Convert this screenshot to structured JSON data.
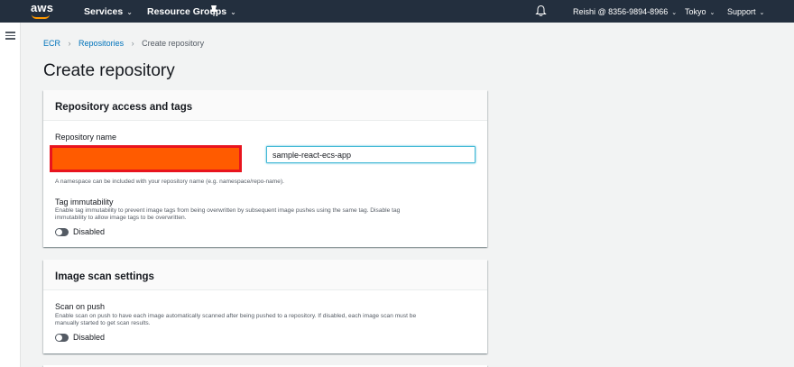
{
  "topnav": {
    "logo": "aws",
    "services": "Services",
    "resource_groups": "Resource Groups",
    "account": "Reishi @ 8356-9894-8966",
    "region": "Tokyo",
    "support": "Support",
    "chevron": "⌄"
  },
  "breadcrumb": {
    "items": [
      "ECR",
      "Repositories",
      "Create repository"
    ],
    "separator": "›"
  },
  "page": {
    "title": "Create repository"
  },
  "repo_access": {
    "header": "Repository access and tags",
    "name_label": "Repository name",
    "name_value": "sample-react-ecs-app",
    "namespace_hint": "A namespace can be included with your repository name (e.g. namespace/repo-name).",
    "tag_immutability_label": "Tag immutability",
    "tag_immutability_desc_1": "Enable tag immutability to prevent image tags from being overwritten by subsequent image pushes using the same tag. Disable tag",
    "tag_immutability_desc_2": "immutability to allow image tags to be overwritten.",
    "tag_immutability_state": "Disabled"
  },
  "image_scan": {
    "header": "Image scan settings",
    "scan_on_push_label": "Scan on push",
    "scan_on_push_desc_1": "Enable scan on push to have each image automatically scanned after being pushed to a repository. If disabled, each image scan must be",
    "scan_on_push_desc_2": "manually started to get scan results.",
    "scan_on_push_state": "Disabled"
  },
  "colors": {
    "nav_bg": "#232f3e",
    "accent_orange": "#ff9900",
    "link_blue": "#0073bb",
    "redaction_fill": "#ff5b00",
    "redaction_border": "#e8141e",
    "focus_border": "#44b9d6"
  }
}
